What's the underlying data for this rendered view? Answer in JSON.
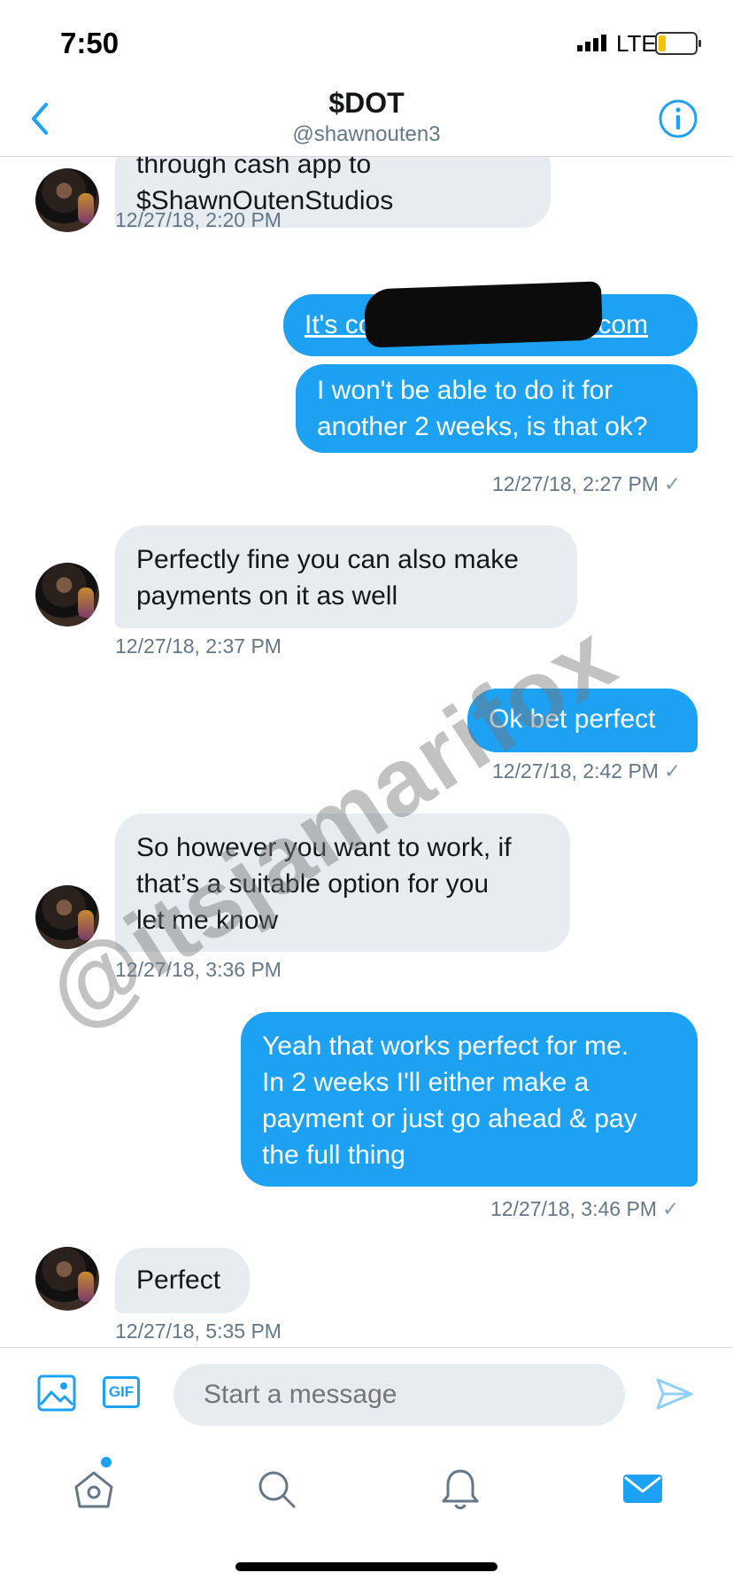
{
  "status_bar": {
    "time": "7:50",
    "network": "LTE",
    "battery_level": 0.2
  },
  "header": {
    "name": "$DOT",
    "handle": "@shawnouten3"
  },
  "messages": [
    {
      "side": "received",
      "lines": [
        "through cash app to",
        "$ShawnOutenStudios"
      ],
      "timestamp": "12/27/18, 2:20 PM"
    },
    {
      "side": "sent",
      "lines": [
        "It's colliecharles@yahoo.com"
      ],
      "timestamp": ""
    },
    {
      "side": "sent",
      "lines": [
        "I won't be able to do it for",
        "another 2 weeks, is that ok?"
      ],
      "timestamp": "12/27/18, 2:27 PM"
    },
    {
      "side": "received",
      "lines": [
        "Perfectly fine you can also make",
        "payments on it as well"
      ],
      "timestamp": "12/27/18, 2:37 PM"
    },
    {
      "side": "sent",
      "lines": [
        "Ok bet perfect"
      ],
      "timestamp": "12/27/18, 2:42 PM"
    },
    {
      "side": "received",
      "lines": [
        "So however you want to work, if",
        "that’s a suitable option for you",
        "let me know"
      ],
      "timestamp": "12/27/18, 3:36 PM"
    },
    {
      "side": "sent",
      "lines": [
        "Yeah that works perfect for me.",
        "In 2 weeks I'll either make a",
        "payment or just go ahead & pay",
        "the full thing"
      ],
      "timestamp": "12/27/18, 3:46 PM"
    },
    {
      "side": "received",
      "lines": [
        "Perfect"
      ],
      "timestamp": "12/27/18, 5:35 PM"
    }
  ],
  "read_check": "✓",
  "watermark": "@itsjamarifox",
  "compose": {
    "gif_label": "GIF",
    "placeholder": "Start a message"
  },
  "tabs": [
    "home-icon",
    "search-icon",
    "notifications-icon",
    "messages-icon"
  ],
  "colors": {
    "accent": "#1da1f2",
    "received_bubble": "#e6ecf0",
    "muted": "#657786"
  }
}
